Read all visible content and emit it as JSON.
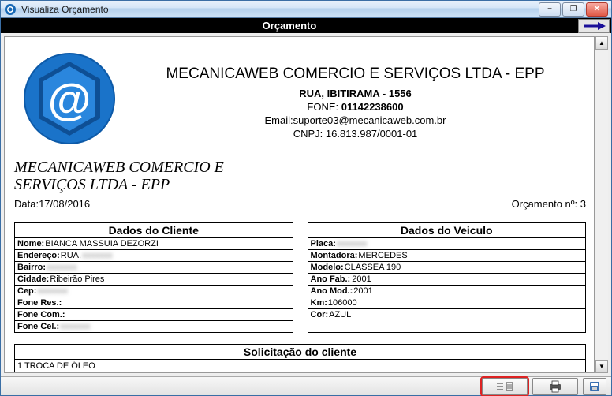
{
  "window": {
    "title": "Visualiza Orçamento"
  },
  "header": {
    "title": "Orçamento"
  },
  "company": {
    "name_line": "MECANICAWEB COMERCIO E SERVIÇOS LTDA - EPP",
    "address": "RUA, IBITIRAMA - 1556",
    "fone_label": "FONE:",
    "fone": "01142238600",
    "email_label": "Email:",
    "email": "suporte03@mecanicaweb.com.br",
    "cnpj_label": "CNPJ:",
    "cnpj": "16.813.987/0001-01",
    "italic1": "MECANICAWEB COMERCIO E",
    "italic2": "SERVIÇOS LTDA - EPP"
  },
  "meta": {
    "date_label": "Data:",
    "date_value": "17/08/2016",
    "num_label": "Orçamento nº:",
    "num_value": "3"
  },
  "client": {
    "section_title": "Dados do Cliente",
    "nome_label": "Nome:",
    "nome_value": "BIANCA MASSUIA DEZORZI",
    "endereco_label": "Endereço:",
    "endereco_value": "RUA,",
    "endereco_blur": "xxxxxxx",
    "bairro_label": "Bairro:",
    "bairro_blur": "xxxxxxx",
    "cidade_label": "Cidade:",
    "cidade_value": "Ribeirão Pires",
    "cep_label": "Cep:",
    "cep_blur": "xxxxxxx",
    "fone_res_label": "Fone Res.:",
    "fone_com_label": "Fone Com.:",
    "fone_cel_label": "Fone Cel.:",
    "fone_cel_blur": "xxxxxxx"
  },
  "vehicle": {
    "section_title": "Dados do Veiculo",
    "placa_label": "Placa:",
    "placa_blur": "xxxxxxx",
    "montadora_label": "Montadora:",
    "montadora_value": "MERCEDES",
    "modelo_label": "Modelo:",
    "modelo_value": "CLASSEA 190",
    "anofab_label": "Ano Fab.:",
    "anofab_value": "2001",
    "anomod_label": "Ano Mod.:",
    "anomod_value": "2001",
    "km_label": "Km:",
    "km_value": "106000",
    "cor_label": "Cor:",
    "cor_value": "AZUL"
  },
  "solicitacao": {
    "section_title": "Solicitação do cliente",
    "item1": "1 TROCA DE ÓLEO"
  },
  "icons": {
    "app": "app-icon",
    "minimize": "−",
    "maximize": "❐",
    "close": "✕",
    "arrow_up": "▲",
    "arrow_down": "▼"
  }
}
